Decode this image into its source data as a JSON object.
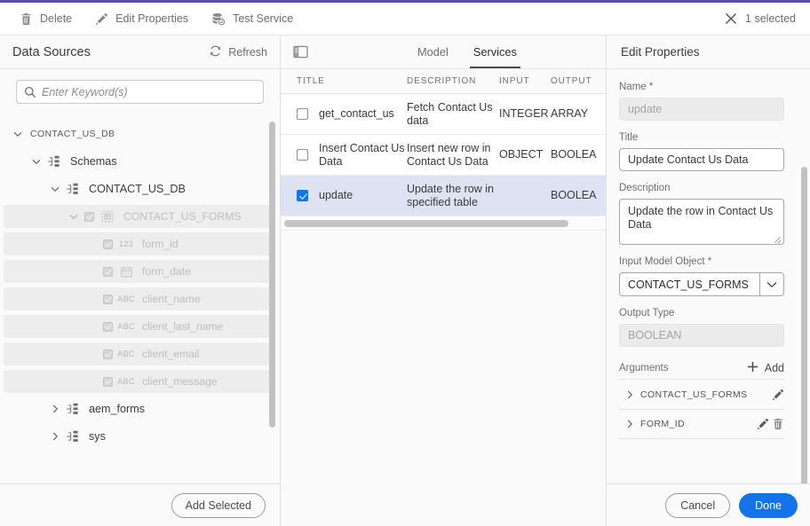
{
  "toolbar": {
    "delete_label": "Delete",
    "edit_properties_label": "Edit Properties",
    "test_service_label": "Test Service",
    "selection_label": "1 selected"
  },
  "left_panel": {
    "title": "Data Sources",
    "refresh_label": "Refresh",
    "search_placeholder": "Enter Keyword(s)",
    "search_value": "",
    "add_selected_label": "Add Selected",
    "tree": [
      {
        "label": "CONTACT_US_DB",
        "indent": 0,
        "caret": "down",
        "icon": "none",
        "checkbox": false,
        "shaded": false,
        "disabled": false,
        "tiny": true
      },
      {
        "label": "Schemas",
        "indent": 1,
        "caret": "down",
        "icon": "schema",
        "checkbox": false,
        "shaded": false,
        "disabled": false,
        "tiny": false
      },
      {
        "label": "CONTACT_US_DB",
        "indent": 2,
        "caret": "down",
        "icon": "schema",
        "checkbox": false,
        "shaded": false,
        "disabled": false,
        "tiny": false
      },
      {
        "label": "CONTACT_US_FORMS",
        "indent": 3,
        "caret": "down",
        "icon": "table",
        "checkbox": true,
        "shaded": true,
        "disabled": true,
        "tiny": false
      },
      {
        "label": "form_id",
        "indent": 4,
        "caret": "none",
        "icon": "123",
        "checkbox": true,
        "shaded": true,
        "disabled": true,
        "tiny": false
      },
      {
        "label": "form_date",
        "indent": 4,
        "caret": "none",
        "icon": "date",
        "checkbox": true,
        "shaded": true,
        "disabled": true,
        "tiny": false
      },
      {
        "label": "client_name",
        "indent": 4,
        "caret": "none",
        "icon": "ABC",
        "checkbox": true,
        "shaded": true,
        "disabled": true,
        "tiny": false
      },
      {
        "label": "client_last_name",
        "indent": 4,
        "caret": "none",
        "icon": "ABC",
        "checkbox": true,
        "shaded": true,
        "disabled": true,
        "tiny": false
      },
      {
        "label": "client_email",
        "indent": 4,
        "caret": "none",
        "icon": "ABC",
        "checkbox": true,
        "shaded": true,
        "disabled": true,
        "tiny": false
      },
      {
        "label": "client_message",
        "indent": 4,
        "caret": "none",
        "icon": "ABC",
        "checkbox": true,
        "shaded": true,
        "disabled": true,
        "tiny": false
      },
      {
        "label": "aem_forms",
        "indent": 2,
        "caret": "right",
        "icon": "schema",
        "checkbox": false,
        "shaded": false,
        "disabled": false,
        "tiny": false
      },
      {
        "label": "sys",
        "indent": 2,
        "caret": "right",
        "icon": "schema",
        "checkbox": false,
        "shaded": false,
        "disabled": false,
        "tiny": false
      }
    ]
  },
  "center_panel": {
    "tabs": [
      {
        "label": "Model",
        "active": false
      },
      {
        "label": "Services",
        "active": true
      }
    ],
    "columns": [
      "TITLE",
      "DESCRIPTION",
      "INPUT",
      "OUTPUT"
    ],
    "rows": [
      {
        "checked": false,
        "title": "get_contact_us",
        "description": "Fetch Contact Us data",
        "input": "INTEGER",
        "output": "ARRAY",
        "selected": false
      },
      {
        "checked": false,
        "title": "Insert Contact Us Data",
        "description": "Insert new row in Contact Us Data",
        "input": "OBJECT",
        "output": "BOOLEA",
        "selected": false
      },
      {
        "checked": true,
        "title": "update",
        "description": "Update the row in specified table",
        "input": "",
        "output": "BOOLEA",
        "selected": true
      }
    ]
  },
  "right_panel": {
    "title": "Edit Properties",
    "name_label": "Name *",
    "name_value": "update",
    "title_label": "Title",
    "title_value": "Update Contact Us Data",
    "description_label": "Description",
    "description_value": "Update the row in Contact Us Data",
    "input_model_label": "Input Model Object *",
    "input_model_value": "CONTACT_US_FORMS",
    "output_type_label": "Output Type",
    "output_type_value": "BOOLEAN",
    "arguments_label": "Arguments",
    "add_label": "Add",
    "arguments": [
      {
        "name": "CONTACT_US_FORMS",
        "can_delete": false
      },
      {
        "name": "FORM_ID",
        "can_delete": true
      }
    ],
    "cancel_label": "Cancel",
    "done_label": "Done"
  },
  "colors": {
    "accent_bar": "#5c4ca8",
    "primary_button": "#1473e6",
    "selected_row": "#dee3f3",
    "panel_bg": "#fafafa"
  }
}
